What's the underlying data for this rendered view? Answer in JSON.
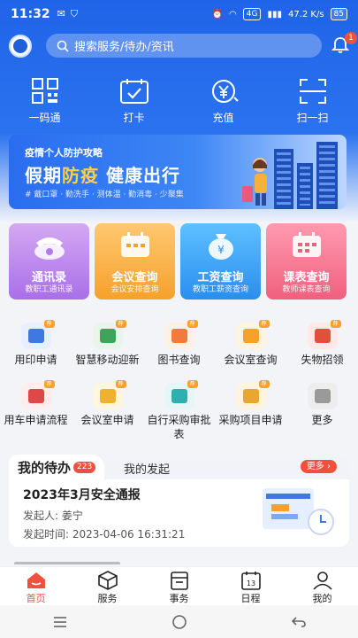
{
  "status": {
    "time": "11:32",
    "network": "4G",
    "speed": "47.2 K/s",
    "battery": "85"
  },
  "search": {
    "placeholder": "搜索服务/待办/资讯"
  },
  "notifications": {
    "count": "1"
  },
  "quick_actions": [
    {
      "label": "一码通",
      "icon": "qr-code-icon"
    },
    {
      "label": "打卡",
      "icon": "calendar-check-icon"
    },
    {
      "label": "充值",
      "icon": "yen-recharge-icon"
    },
    {
      "label": "扫一扫",
      "icon": "scan-icon"
    }
  ],
  "banner": {
    "subtitle": "疫情个人防护攻略",
    "title_a": "假期",
    "title_b": "防疫",
    "title_c": " 健康出行",
    "tags": "# 戴口罩 · 勤洗手 · 测体温 · 勤消毒 · 少聚集"
  },
  "cards": [
    {
      "title": "通讯录",
      "subtitle": "教职工通讯录"
    },
    {
      "title": "会议查询",
      "subtitle": "会议安排查询"
    },
    {
      "title": "工资查询",
      "subtitle": "教职工薪资查询"
    },
    {
      "title": "课表查询",
      "subtitle": "教师课表查询"
    }
  ],
  "grid": [
    [
      {
        "label": "用印申请",
        "badge": "荐",
        "color": "#e8f0ff",
        "sym": "#3e78e0"
      },
      {
        "label": "智慧移动迎新",
        "badge": "荐",
        "color": "#e9f5ea",
        "sym": "#3fa35a"
      },
      {
        "label": "图书查询",
        "badge": "荐",
        "color": "#fff0e6",
        "sym": "#f07b3c"
      },
      {
        "label": "会议室查询",
        "badge": "荐",
        "color": "#fff4e0",
        "sym": "#f6a12c"
      },
      {
        "label": "失物招领",
        "badge": "荐",
        "color": "#ffe9e6",
        "sym": "#e0503c"
      }
    ],
    [
      {
        "label": "用车申请流程",
        "badge": "荐",
        "color": "#ffecec",
        "sym": "#e04848"
      },
      {
        "label": "会议室申请",
        "badge": "荐",
        "color": "#fff6e0",
        "sym": "#f0b030"
      },
      {
        "label": "自行采购审批表",
        "badge": "荐",
        "color": "#e6f6f6",
        "sym": "#2fb0b0"
      },
      {
        "label": "采购项目申请",
        "badge": "荐",
        "color": "#fff4e0",
        "sym": "#e8a830"
      },
      {
        "label": "更多",
        "badge": "",
        "color": "#ededed",
        "sym": "#9a9a9a"
      }
    ]
  ],
  "pending": {
    "tab_active": "我的待办",
    "count": "223",
    "tab_other": "我的发起",
    "more": "更多",
    "title": "2023年3月安全通报",
    "initiator_label": "发起人:",
    "initiator": "姜宁",
    "time_label": "发起时间:",
    "time": "2023-04-06 16:31:21"
  },
  "tabbar": [
    {
      "label": "首页",
      "icon": "home-icon",
      "active": true
    },
    {
      "label": "服务",
      "icon": "cube-icon",
      "active": false
    },
    {
      "label": "事务",
      "icon": "clipboard-icon",
      "active": false
    },
    {
      "label": "日程",
      "icon": "calendar-icon",
      "active": false
    },
    {
      "label": "我的",
      "icon": "person-icon",
      "active": false
    }
  ],
  "colors": {
    "primary": "#1f64e8",
    "accent": "#f0503c"
  }
}
